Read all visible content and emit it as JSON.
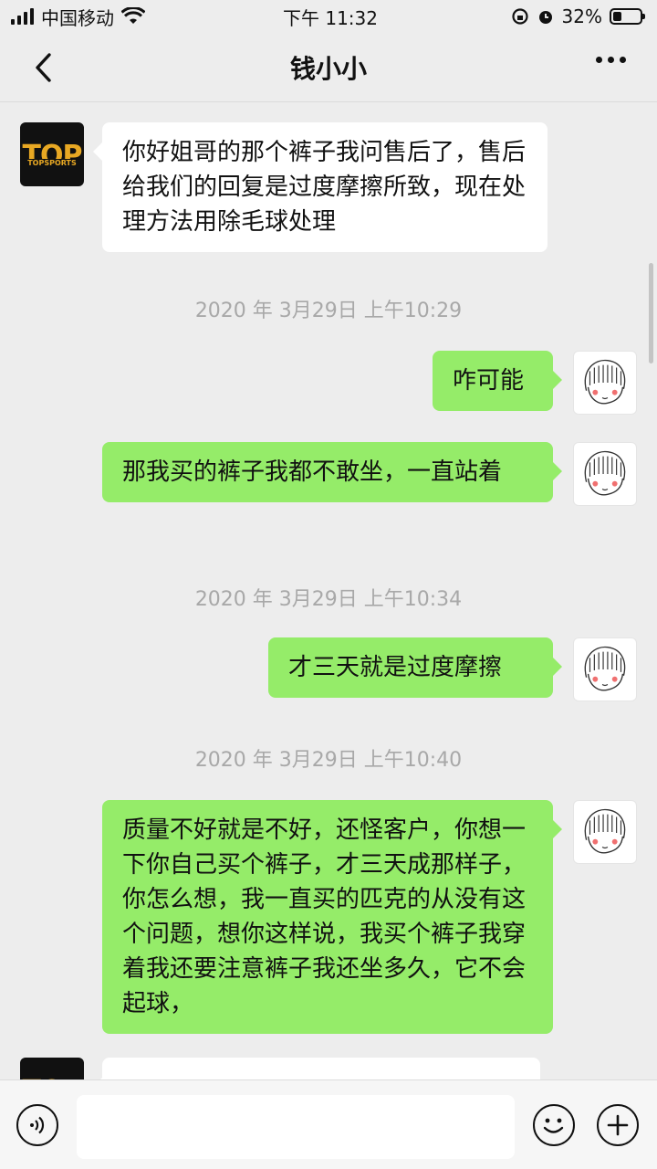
{
  "status_bar": {
    "carrier": "中国移动",
    "time": "下午 11:32",
    "battery_percent": "32%",
    "battery_level": 0.32
  },
  "nav": {
    "title": "钱小小",
    "back_icon": "chevron-left-icon",
    "more_icon": "more-dots-icon"
  },
  "contact_avatar": {
    "brand_big": "TOP",
    "brand_small": "TOPSPORTS"
  },
  "messages": [
    {
      "type": "message",
      "direction": "in",
      "text": "你好姐哥的那个裤子我问售后了，售后给我们的回复是过度摩擦所致，现在处理方法用除毛球处理"
    },
    {
      "type": "timestamp",
      "text": "2020 年 3月29日 上午10:29"
    },
    {
      "type": "message",
      "direction": "out",
      "text": "咋可能"
    },
    {
      "type": "message",
      "direction": "out",
      "text": "那我买的裤子我都不敢坐，一直站着"
    },
    {
      "type": "timestamp",
      "text": "2020 年 3月29日 上午10:34"
    },
    {
      "type": "message",
      "direction": "out",
      "text": "才三天就是过度摩擦"
    },
    {
      "type": "timestamp",
      "text": "2020 年 3月29日 上午10:40"
    },
    {
      "type": "message",
      "direction": "out",
      "text": "质量不好就是不好，还怪客户，你想一下你自己买个裤子，才三天成那样子，你怎么想，我一直买的匹克的从没有这个问题，想你这样说，我买个裤子我穿着我还要注意裤子我还坐多久，它不会起球，"
    },
    {
      "type": "message",
      "direction": "in",
      "text": ""
    }
  ],
  "input_bar": {
    "voice_icon": "voice-icon",
    "emoji_icon": "emoji-icon",
    "plus_icon": "plus-icon",
    "input_value": ""
  },
  "colors": {
    "background": "#ededed",
    "outgoing_bubble": "#95ec69",
    "incoming_bubble": "#ffffff",
    "timestamp": "#a8a8a8",
    "brand_gold": "#e8a823"
  }
}
